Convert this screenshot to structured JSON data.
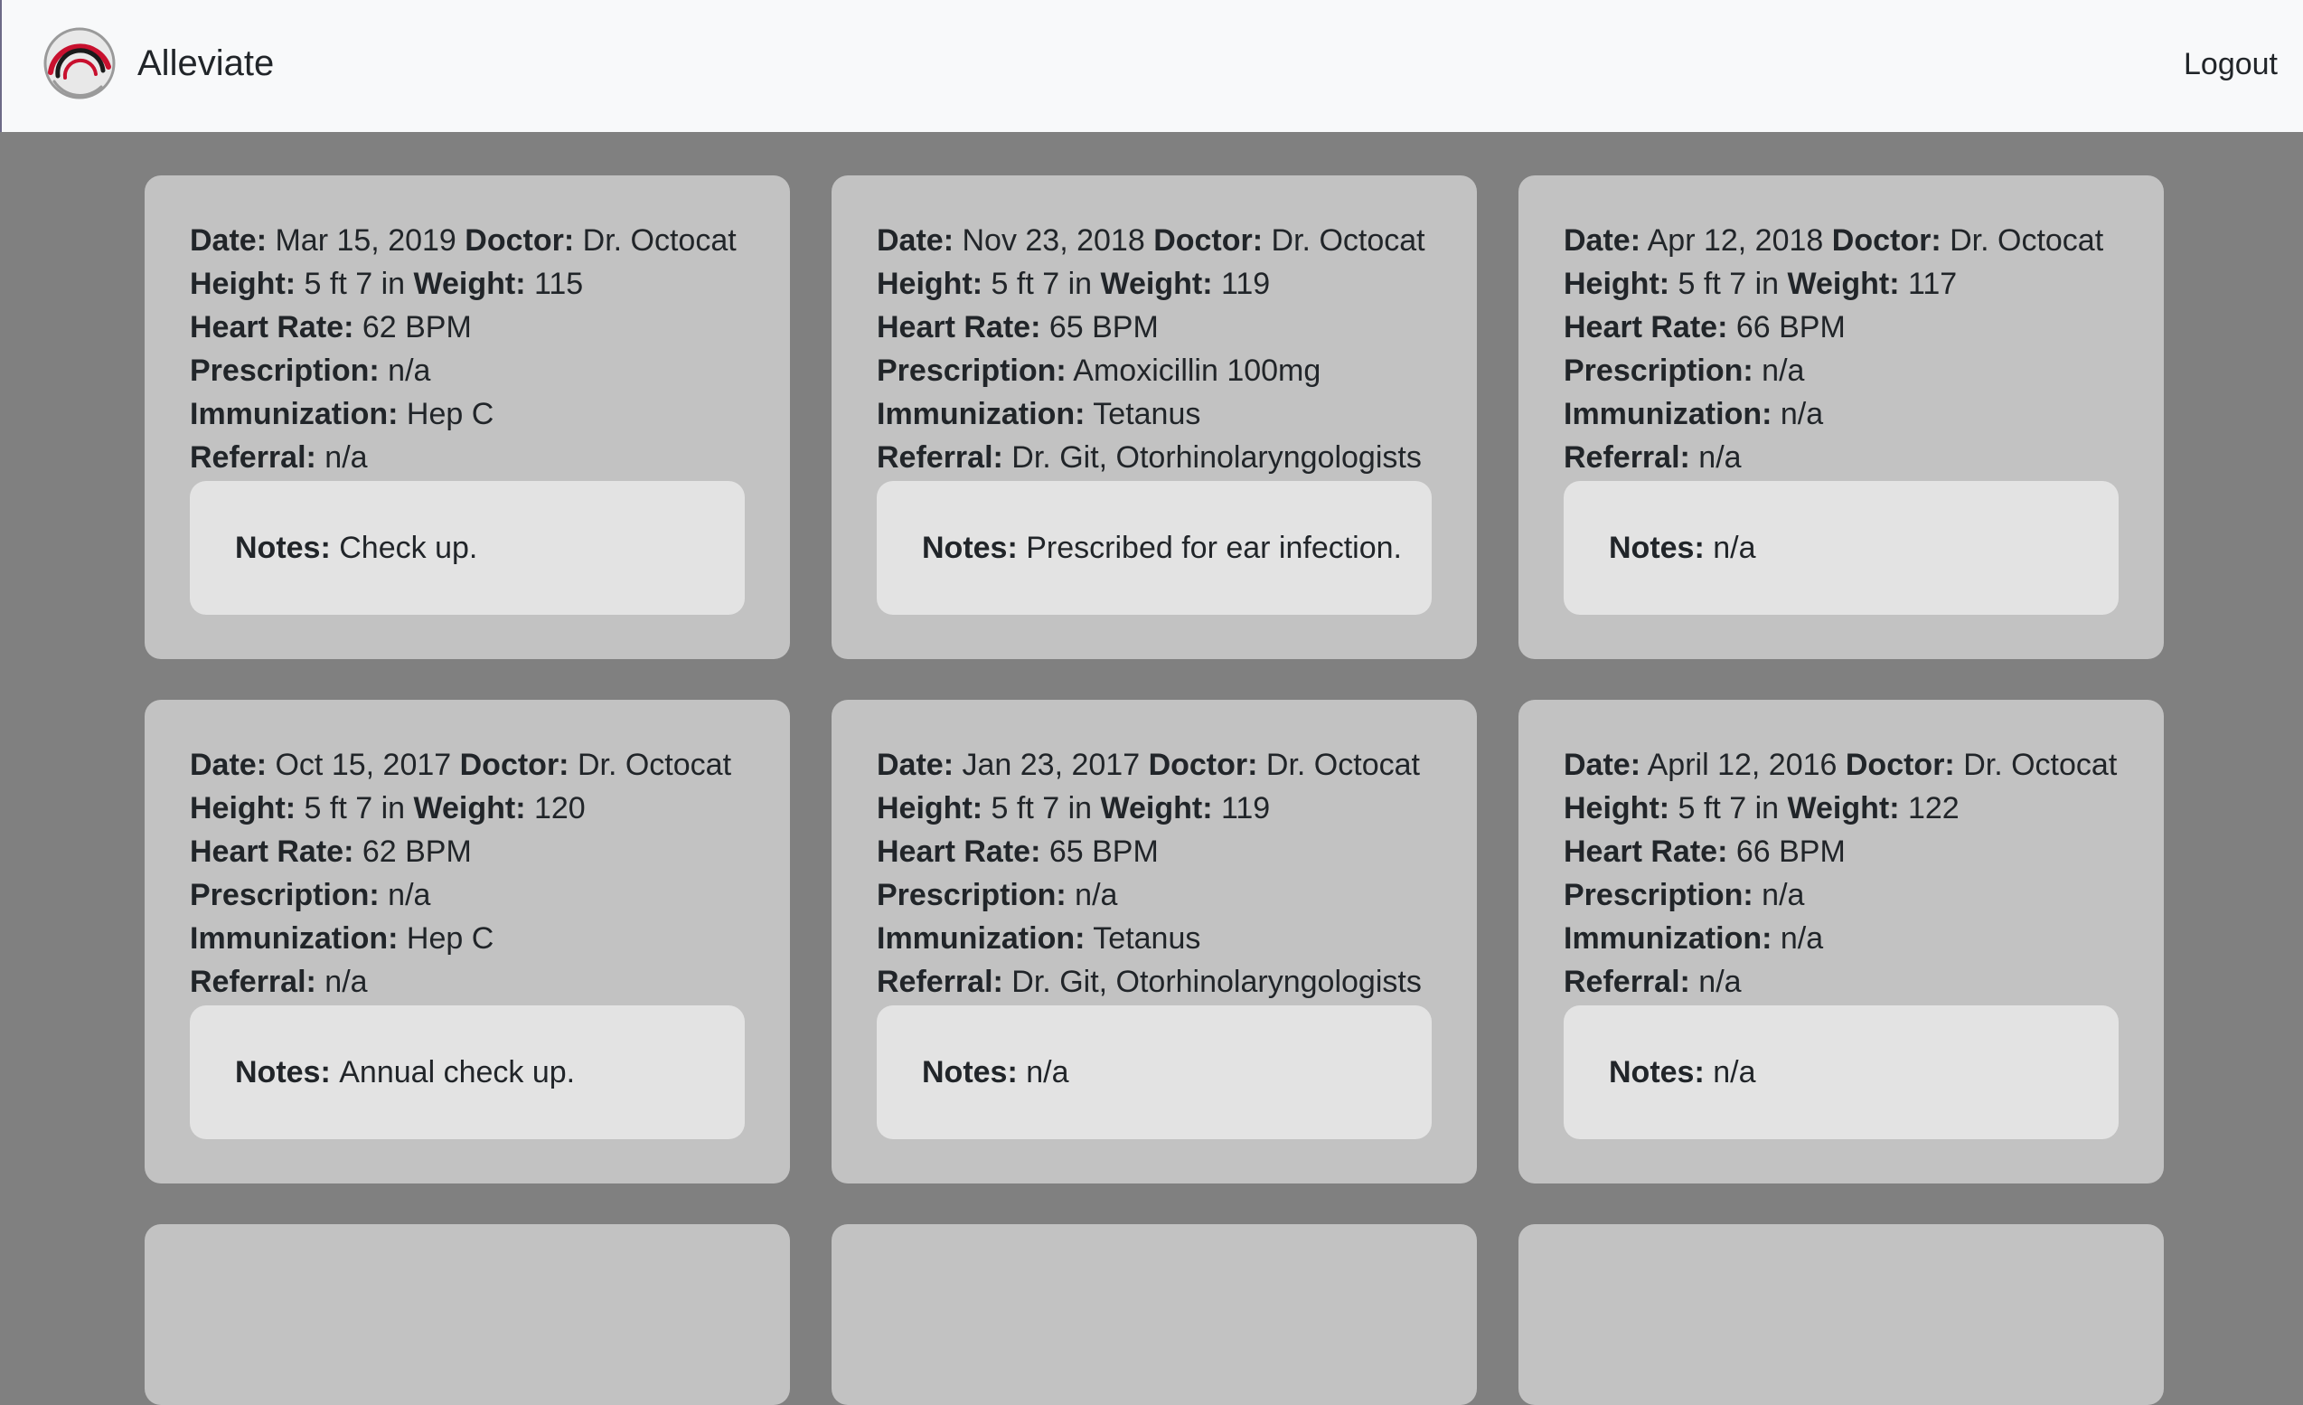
{
  "navbar": {
    "brand_name": "Alleviate",
    "logout_label": "Logout",
    "logo_colors": [
      "#c8102e",
      "#1a1a1a",
      "#9a9a9a"
    ]
  },
  "labels": {
    "date": "Date:",
    "doctor": "Doctor:",
    "height": "Height:",
    "weight": "Weight:",
    "heart_rate": "Heart Rate:",
    "prescription": "Prescription:",
    "immunization": "Immunization:",
    "referral": "Referral:",
    "notes": "Notes:"
  },
  "records": [
    {
      "date": "Mar 15, 2019",
      "doctor": "Dr. Octocat",
      "height": "5 ft 7 in",
      "weight": "115",
      "heart_rate": "62 BPM",
      "prescription": "n/a",
      "immunization": "Hep C",
      "referral": "n/a",
      "notes": "Check up."
    },
    {
      "date": "Nov 23, 2018",
      "doctor": "Dr. Octocat",
      "height": "5 ft 7 in",
      "weight": "119",
      "heart_rate": "65 BPM",
      "prescription": "Amoxicillin 100mg",
      "immunization": "Tetanus",
      "referral": "Dr. Git, Otorhinolaryngologists",
      "notes": "Prescribed for ear infection."
    },
    {
      "date": "Apr 12, 2018",
      "doctor": "Dr. Octocat",
      "height": "5 ft 7 in",
      "weight": "117",
      "heart_rate": "66 BPM",
      "prescription": "n/a",
      "immunization": "n/a",
      "referral": "n/a",
      "notes": "n/a"
    },
    {
      "date": "Oct 15, 2017",
      "doctor": "Dr. Octocat",
      "height": "5 ft 7 in",
      "weight": "120",
      "heart_rate": "62 BPM",
      "prescription": "n/a",
      "immunization": "Hep C",
      "referral": "n/a",
      "notes": "Annual check up."
    },
    {
      "date": "Jan 23, 2017",
      "doctor": "Dr. Octocat",
      "height": "5 ft 7 in",
      "weight": "119",
      "heart_rate": "65 BPM",
      "prescription": "n/a",
      "immunization": "Tetanus",
      "referral": "Dr. Git, Otorhinolaryngologists",
      "notes": "n/a"
    },
    {
      "date": "April 12, 2016",
      "doctor": "Dr. Octocat",
      "height": "5 ft 7 in",
      "weight": "122",
      "heart_rate": "66 BPM",
      "prescription": "n/a",
      "immunization": "n/a",
      "referral": "n/a",
      "notes": "n/a"
    }
  ]
}
